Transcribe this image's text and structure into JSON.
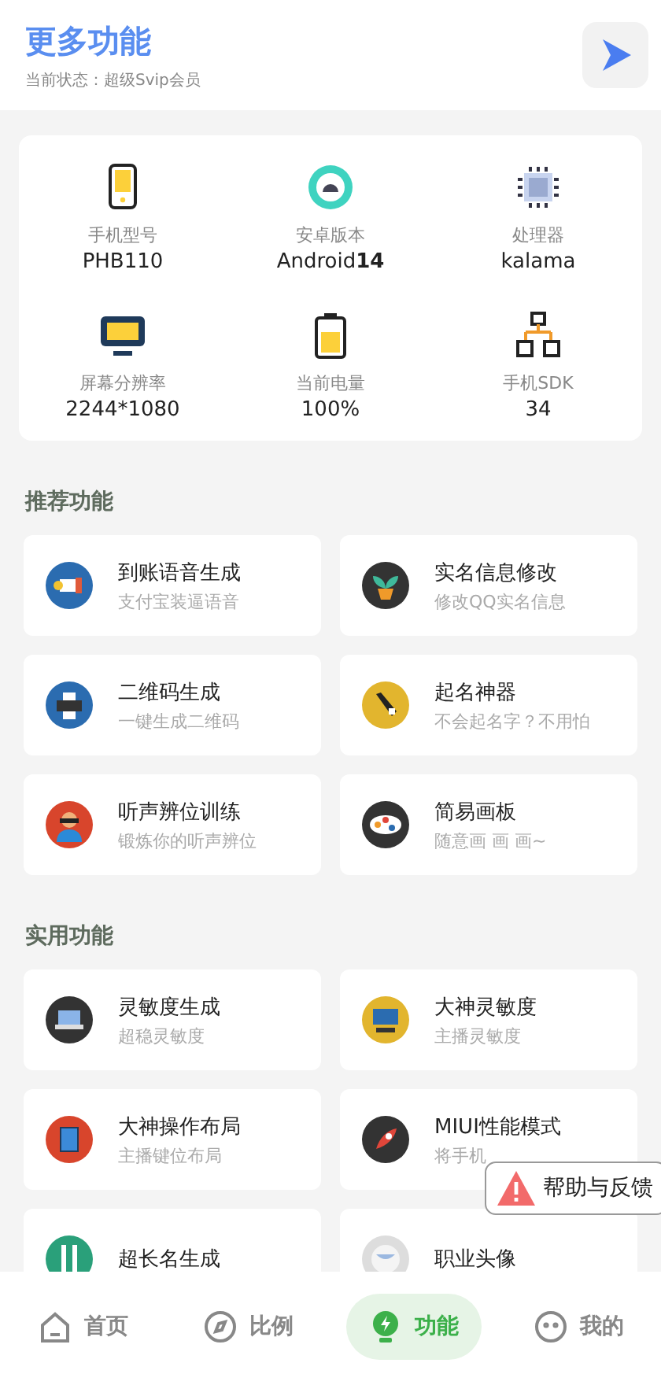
{
  "header": {
    "title": "更多功能",
    "status": "当前状态：超级Svip会员"
  },
  "device_info": [
    {
      "label": "手机型号",
      "value": "PHB110"
    },
    {
      "label": "安卓版本",
      "value": "Android**14**"
    },
    {
      "label": "处理器",
      "value": "kalama"
    },
    {
      "label": "屏幕分辨率",
      "value": "2244*1080"
    },
    {
      "label": "当前电量",
      "value": "100%"
    },
    {
      "label": "手机SDK",
      "value": "34"
    }
  ],
  "sections": [
    {
      "title": "推荐功能",
      "items": [
        {
          "title": "到账语音生成",
          "subtitle": "支付宝装逼语音"
        },
        {
          "title": "实名信息修改",
          "subtitle": "修改QQ实名信息"
        },
        {
          "title": "二维码生成",
          "subtitle": "一键生成二维码"
        },
        {
          "title": "起名神器",
          "subtitle": "不会起名字？不用怕"
        },
        {
          "title": "听声辨位训练",
          "subtitle": "锻炼你的听声辨位"
        },
        {
          "title": "简易画板",
          "subtitle": "随意画 画 画~"
        }
      ]
    },
    {
      "title": "实用功能",
      "items": [
        {
          "title": "灵敏度生成",
          "subtitle": "超稳灵敏度"
        },
        {
          "title": "大神灵敏度",
          "subtitle": "主播灵敏度"
        },
        {
          "title": "大神操作布局",
          "subtitle": "主播键位布局"
        },
        {
          "title": "MIUI性能模式",
          "subtitle": "将手机"
        },
        {
          "title": "超长名生成"
        },
        {
          "title": "职业头像"
        }
      ]
    }
  ],
  "help_button": {
    "label": "帮助与反馈"
  },
  "nav": [
    {
      "label": "首页",
      "selected": false
    },
    {
      "label": "比例",
      "selected": false
    },
    {
      "label": "功能",
      "selected": true
    },
    {
      "label": "我的",
      "selected": false
    }
  ]
}
